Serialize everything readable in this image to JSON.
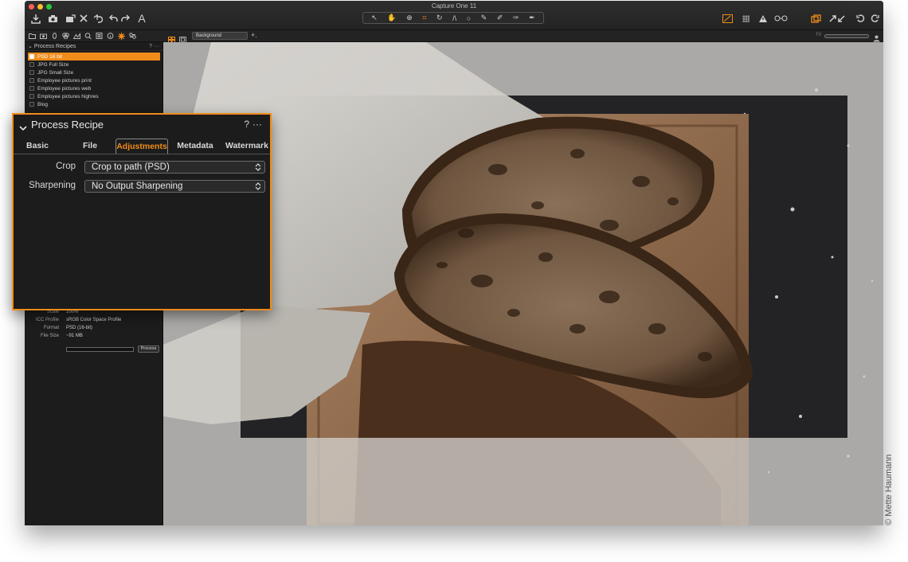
{
  "window": {
    "title": "Capture One 11"
  },
  "toolbar": {
    "left_icons": [
      "import-icon",
      "camera-icon",
      "export-icon",
      "delete-icon",
      "undo-history-icon",
      "undo-icon",
      "redo-icon",
      "text-adjust-icon"
    ],
    "cursor_tools": [
      "select-cursor-icon",
      "pan-icon",
      "zoom-icon",
      "crop-icon",
      "rotate-icon",
      "keystone-icon",
      "circle-mask-icon",
      "brush-icon",
      "eraser-icon",
      "picker-icon",
      "annotate-icon"
    ],
    "right_icons": [
      "proof-icon",
      "grid-icon",
      "warning-icon",
      "glasses-icon",
      "copy-icon",
      "apply-icon",
      "reset-icon",
      "refresh-icon"
    ]
  },
  "viewer_bar": {
    "background_select": "Background",
    "fit_label": "Fit"
  },
  "left_panel": {
    "header": "Process Recipes",
    "header_help": "?",
    "header_more": "···",
    "recipes": [
      {
        "label": "PSD 16 bit",
        "selected": true
      },
      {
        "label": "JPG Full Size",
        "selected": false
      },
      {
        "label": "JPG Small Size",
        "selected": false
      },
      {
        "label": "Employee pictures print",
        "selected": false
      },
      {
        "label": "Employee pictures web",
        "selected": false
      },
      {
        "label": "Employee pictures highres",
        "selected": false
      },
      {
        "label": "Blog",
        "selected": false
      }
    ],
    "summary": [
      {
        "key": "Scale",
        "value": "100%"
      },
      {
        "key": "ICC Profile",
        "value": "sRGB Color Space Profile"
      },
      {
        "key": "Format",
        "value": "PSD (16-bit)"
      },
      {
        "key": "File Size",
        "value": "~91 MB"
      }
    ],
    "process_button": "Process"
  },
  "callout": {
    "title": "Process Recipe",
    "help": "?",
    "more": "···",
    "tabs": [
      {
        "label": "Basic",
        "active": false
      },
      {
        "label": "File",
        "active": false
      },
      {
        "label": "Adjustments",
        "active": true
      },
      {
        "label": "Metadata",
        "active": false
      },
      {
        "label": "Watermark",
        "active": false
      }
    ],
    "fields": [
      {
        "label": "Crop",
        "value": "Crop to path (PSD)"
      },
      {
        "label": "Sharpening",
        "value": "No Output Sharpening"
      }
    ]
  },
  "credit": "© Mette Haumann",
  "colors": {
    "accent": "#f08c1a",
    "panel": "#1c1c1c",
    "viewer_bg": "#c6c4c1"
  }
}
